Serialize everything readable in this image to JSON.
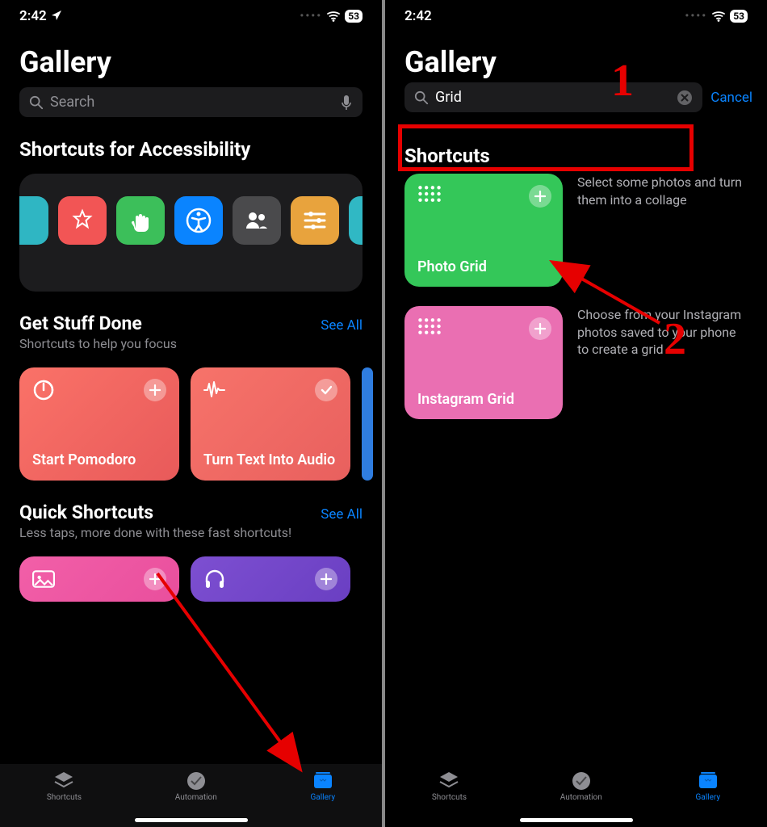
{
  "status": {
    "time": "2:42",
    "battery": "53"
  },
  "left": {
    "title": "Gallery",
    "search_placeholder": "Search",
    "accessibility_heading": "Shortcuts for Accessibility",
    "get_stuff": {
      "heading": "Get Stuff Done",
      "subtitle": "Shortcuts to help you focus",
      "see_all": "See All",
      "tiles": [
        {
          "label": "Start Pomodoro"
        },
        {
          "label": "Turn Text Into Audio"
        }
      ]
    },
    "quick": {
      "heading": "Quick Shortcuts",
      "subtitle": "Less taps, more done with these fast shortcuts!",
      "see_all": "See All"
    },
    "tabs": {
      "shortcuts": "Shortcuts",
      "automation": "Automation",
      "gallery": "Gallery"
    }
  },
  "right": {
    "title": "Gallery",
    "search_value": "Grid",
    "cancel": "Cancel",
    "results_heading": "Shortcuts",
    "results": [
      {
        "label": "Photo Grid",
        "desc": "Select some photos and turn them into a collage"
      },
      {
        "label": "Instagram Grid",
        "desc": "Choose from your Instagram photos saved to your phone to create a grid"
      }
    ],
    "tabs": {
      "shortcuts": "Shortcuts",
      "automation": "Automation",
      "gallery": "Gallery"
    }
  },
  "annotations": {
    "num1": "1",
    "num2": "2"
  }
}
